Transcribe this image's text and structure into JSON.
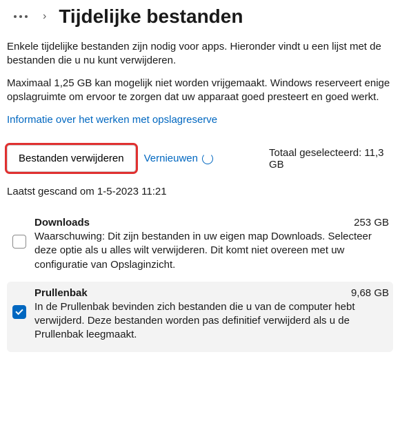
{
  "header": {
    "title": "Tijdelijke bestanden"
  },
  "intro": "Enkele tijdelijke bestanden zijn nodig voor apps. Hieronder vindt u een lijst met de bestanden die u nu kunt verwijderen.",
  "note": "Maximaal 1,25 GB kan mogelijk niet worden vrijgemaakt. Windows reserveert enige opslagruimte om ervoor te zorgen dat uw apparaat goed presteert en goed werkt.",
  "link": "Informatie over het werken met opslagreserve",
  "actions": {
    "delete": "Bestanden verwijderen",
    "refresh": "Vernieuwen",
    "total_label": "Totaal geselecteerd: 11,3 GB"
  },
  "scan": "Laatst gescand om 1-5-2023 11:21",
  "items": [
    {
      "title": "Downloads",
      "size": "253 GB",
      "desc": "Waarschuwing: Dit zijn bestanden in uw eigen map Downloads. Selecteer deze optie als u alles wilt verwijderen. Dit komt niet overeen met uw configuratie van Opslaginzicht.",
      "checked": false
    },
    {
      "title": "Prullenbak",
      "size": "9,68 GB",
      "desc": "In de Prullenbak bevinden zich bestanden die u van de computer hebt verwijderd. Deze bestanden worden pas definitief verwijderd als u de Prullenbak leegmaakt.",
      "checked": true
    }
  ]
}
